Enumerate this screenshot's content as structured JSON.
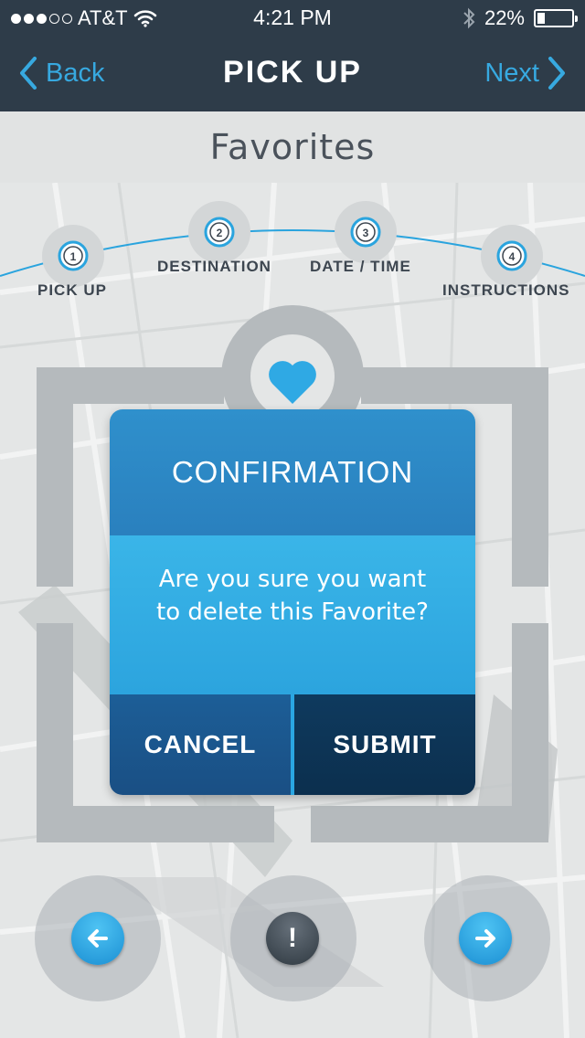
{
  "status_bar": {
    "carrier": "AT&T",
    "time": "4:21 PM",
    "battery": "22%",
    "battery_level": 0.22
  },
  "nav": {
    "back_label": "Back",
    "title": "PICK UP",
    "next_label": "Next"
  },
  "page": {
    "heading": "Favorites"
  },
  "steps": [
    {
      "number": "1",
      "label": "PICK UP"
    },
    {
      "number": "2",
      "label": "DESTINATION"
    },
    {
      "number": "3",
      "label": "DATE / TIME"
    },
    {
      "number": "4",
      "label": "INSTRUCTIONS"
    }
  ],
  "modal": {
    "title": "CONFIRMATION",
    "message": "Are you sure you want to delete this Favorite?",
    "cancel_label": "CANCEL",
    "submit_label": "SUBMIT"
  },
  "bottom": {
    "alert_glyph": "!"
  },
  "icons": [
    "wifi-icon",
    "bluetooth-icon",
    "heart-icon",
    "arrow-left-icon",
    "arrow-right-icon",
    "alert-icon",
    "chevron-left-icon",
    "chevron-right-icon"
  ],
  "colors": {
    "navbar": "#2e3c49",
    "accent": "#37a9e0",
    "modal_header": "#2a80be",
    "modal_body": "#2ca4de",
    "cancel": "#1a4f84",
    "submit": "#0c2f4e"
  }
}
